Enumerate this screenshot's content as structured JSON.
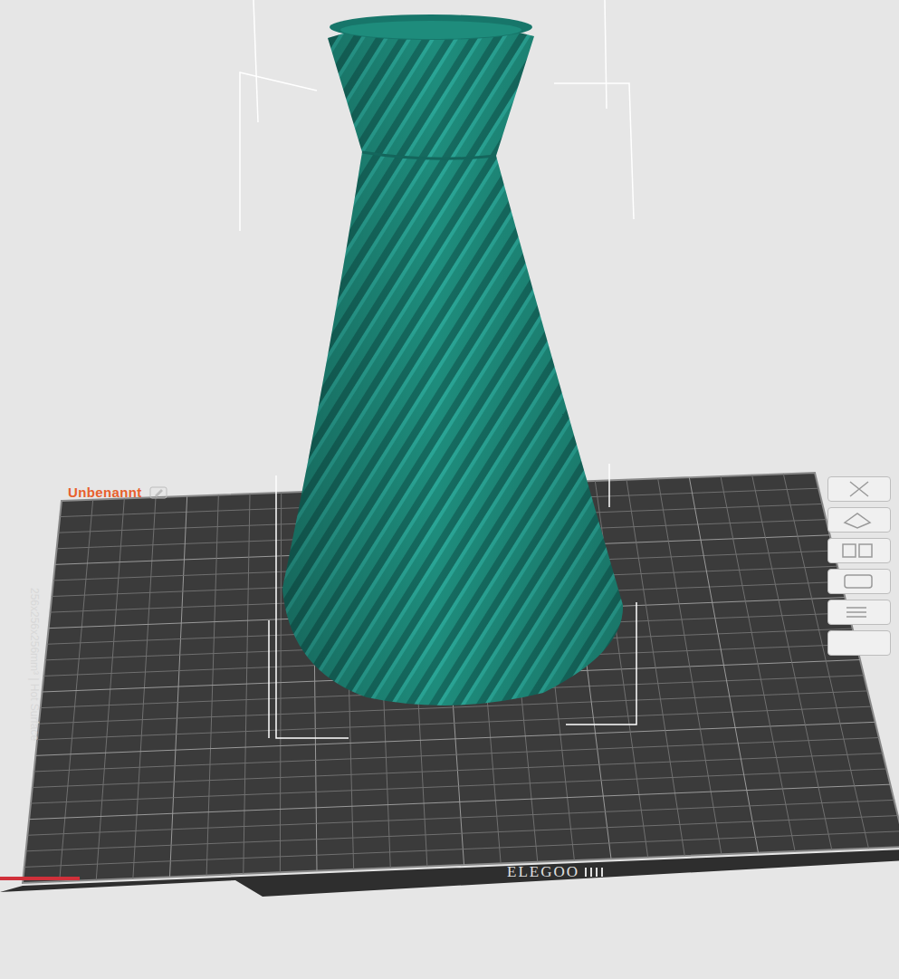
{
  "project": {
    "title": "Unbenannt"
  },
  "plate": {
    "label": "256x256x256mm³ | Hot Surface",
    "logo": "ELEGOO"
  }
}
